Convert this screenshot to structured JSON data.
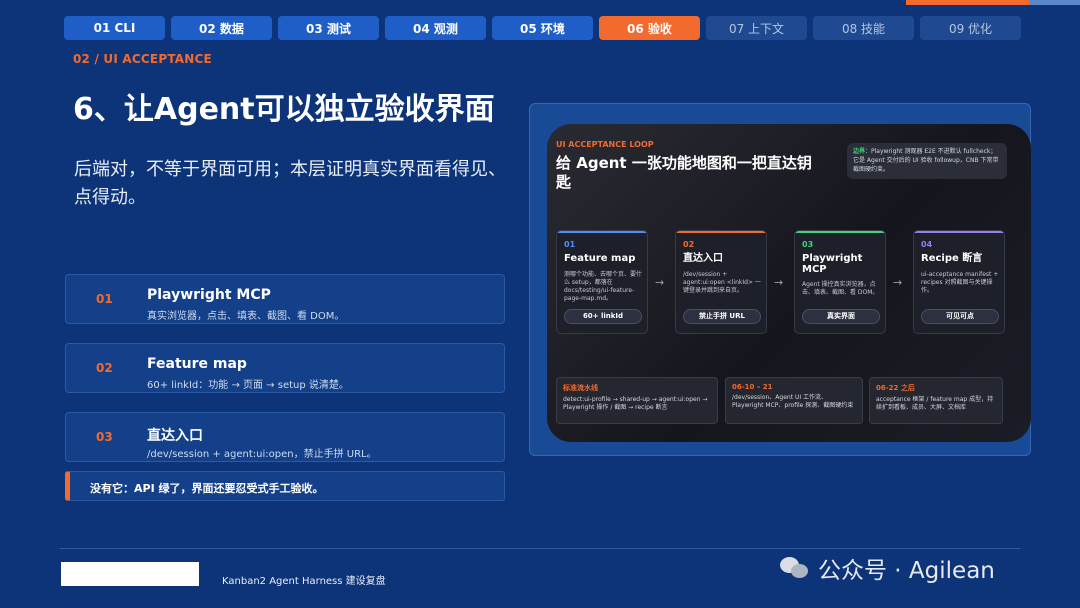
{
  "tabs": [
    {
      "label": "01 CLI"
    },
    {
      "label": "02 数据"
    },
    {
      "label": "03 测试"
    },
    {
      "label": "04 观测"
    },
    {
      "label": "05 环境"
    },
    {
      "label": "06 验收"
    },
    {
      "label": "07 上下文"
    },
    {
      "label": "08 技能"
    },
    {
      "label": "09 优化"
    }
  ],
  "header": {
    "eyebrow": "02 / UI ACCEPTANCE",
    "title": "6、让Agent可以独立验收界面",
    "subtitle": "后端对，不等于界面可用；本层证明真实界面看得见、点得动。"
  },
  "items": [
    {
      "num": "01",
      "name": "Playwright MCP",
      "desc": "真实浏览器，点击、填表、截图、看 DOM。"
    },
    {
      "num": "02",
      "name": "Feature map",
      "desc": "60+ linkId：功能 → 页面 → setup 说清楚。"
    },
    {
      "num": "03",
      "name": "直达入口",
      "desc": "/dev/session + agent:ui:open，禁止手拼 URL。"
    }
  ],
  "warning": "没有它：API 绿了，界面还要忍受式手工验收。",
  "panel": {
    "eyebrow": "UI ACCEPTANCE LOOP",
    "title": "给 Agent 一张功能地图和一把直达钥匙",
    "note_label": "边界：",
    "note_text": "Playwright 测观器 E2E 不进默认 fullcheck；它是 Agent 交付后的 UI 验收 followup，CNB 下常带截图硬约束。",
    "steps": [
      {
        "num": "01",
        "name": "Feature map",
        "desc": "测哪个功能、去哪个页、要什么 setup，都落在 docs/testing/ui-feature-page-map.md。",
        "chip": "60+ linkId"
      },
      {
        "num": "02",
        "name": "直达入口",
        "desc": "/dev/session + agent:ui:open <linkId> 一键登录并跳到来自页。",
        "chip": "禁止手拼 URL"
      },
      {
        "num": "03",
        "name": "Playwright MCP",
        "desc": "Agent 操控真实浏览器，点击、填表、截图、看 DOM。",
        "chip": "真实界面"
      },
      {
        "num": "04",
        "name": "Recipe 断言",
        "desc": "ui-acceptance manifest + recipes 对照截图与关键操作。",
        "chip": "可见可点"
      }
    ],
    "arrow": "→",
    "bands": [
      {
        "head": "标准流水线",
        "text": "detect:ui-profile → shared-up → agent:ui:open → Playwright 操作 / 截图 → recipe 断言"
      },
      {
        "head": "06-10 – 21",
        "text": "/dev/session、Agent UI 工作流、Playwright MCP、profile 探测、截图硬约束"
      },
      {
        "head": "06-22 之后",
        "text": "acceptance 框架 / feature map 成型，持续扩到看板、成员、大屏、文档库"
      }
    ]
  },
  "footer": {
    "caption": "Kanban2 Agent Harness 建设复盘",
    "watermark": "公众号 · Agilean"
  },
  "colors": {
    "background": "#0d3478",
    "accent": "#f26a2e",
    "tab": "#1e5ec6",
    "step_colors": [
      "#4f8ef7",
      "#f26a2e",
      "#46d27a",
      "#9b7cf0"
    ]
  }
}
